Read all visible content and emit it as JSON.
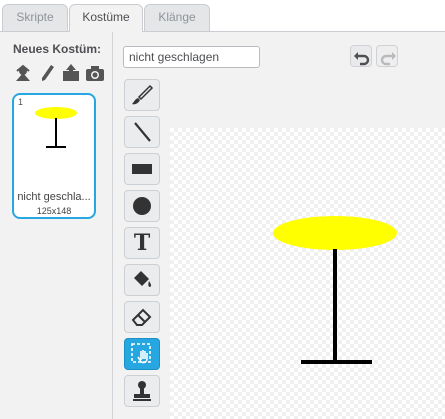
{
  "tabs": [
    {
      "label": "Skripte",
      "active": false
    },
    {
      "label": "Kostüme",
      "active": true
    },
    {
      "label": "Klänge",
      "active": false
    }
  ],
  "left_panel": {
    "new_costume_label": "Neues Kostüm:",
    "new_costume_icons": [
      "sprite-library-icon",
      "paint-brush-icon",
      "upload-icon",
      "camera-icon"
    ],
    "costumes": [
      {
        "number": "1",
        "name": "nicht geschla...",
        "size": "125x148",
        "selected": true
      }
    ]
  },
  "editor": {
    "costume_name_value": "nicht geschlagen",
    "undo_icon": "undo-icon",
    "redo_icon": "redo-icon",
    "tools": [
      {
        "name": "brush-tool",
        "icon": "brush-icon",
        "active": false
      },
      {
        "name": "line-tool",
        "icon": "line-icon",
        "active": false
      },
      {
        "name": "rectangle-tool",
        "icon": "rectangle-icon",
        "active": false
      },
      {
        "name": "ellipse-tool",
        "icon": "ellipse-icon",
        "active": false
      },
      {
        "name": "text-tool",
        "icon": "text-icon",
        "label": "T",
        "active": false
      },
      {
        "name": "fill-tool",
        "icon": "paint-bucket-icon",
        "active": false
      },
      {
        "name": "eraser-tool",
        "icon": "eraser-icon",
        "active": false
      },
      {
        "name": "select-tool",
        "icon": "select-icon",
        "active": true
      },
      {
        "name": "stamp-tool",
        "icon": "stamp-icon",
        "active": false
      }
    ]
  },
  "colors": {
    "accent": "#27a7e1",
    "costume_yellow": "#ffff00",
    "costume_black": "#000000"
  }
}
